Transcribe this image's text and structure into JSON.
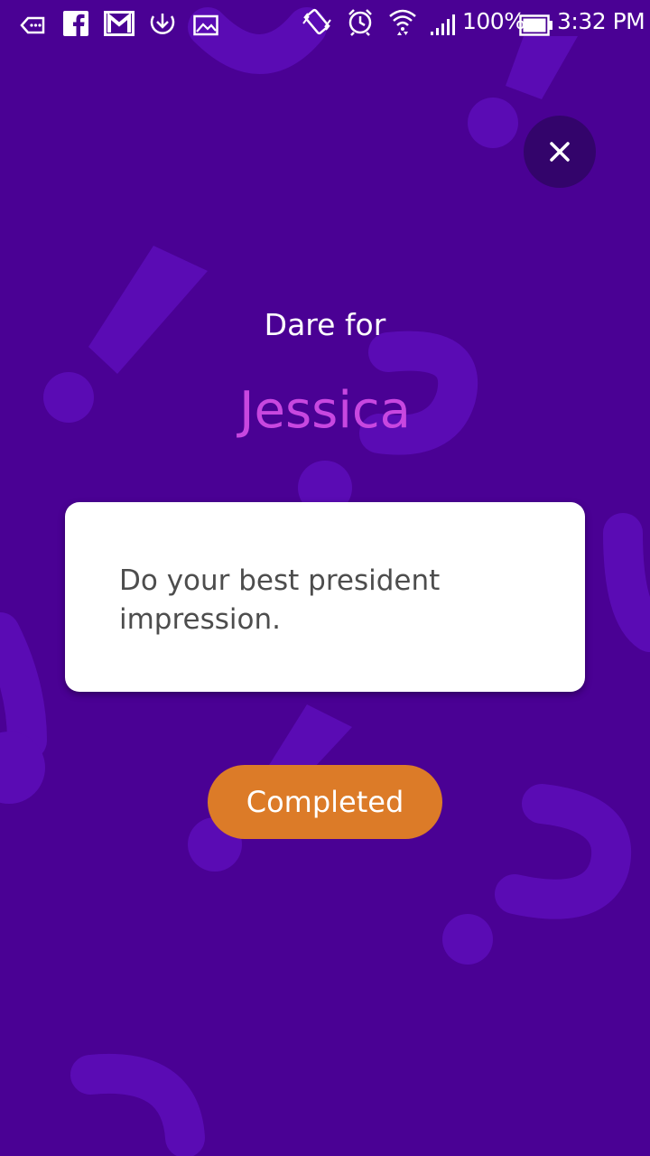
{
  "status_bar": {
    "battery_percent": "100%",
    "time": "3:32 PM",
    "icons": [
      "message-icon",
      "facebook-icon",
      "gmail-icon",
      "download-icon",
      "image-icon",
      "vibrate-icon",
      "alarm-icon",
      "wifi-icon",
      "signal-icon",
      "battery-icon"
    ]
  },
  "dare": {
    "label": "Dare for",
    "player_name": "Jessica",
    "text": "Do your best president impression."
  },
  "actions": {
    "completed_label": "Completed",
    "close_icon": "close-icon"
  },
  "colors": {
    "background": "#4a0194",
    "decoration": "#5a0bb4",
    "name_accent": "#c847e0",
    "button": "#dc7b28",
    "close_button_bg": "#33046b"
  }
}
